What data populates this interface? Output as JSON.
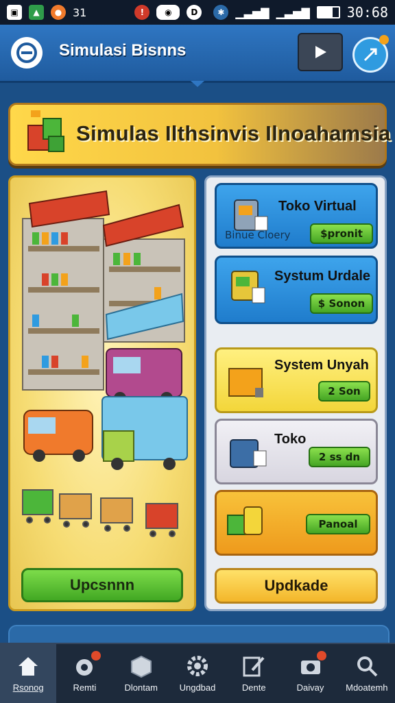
{
  "status_bar": {
    "left_text": "31",
    "time": "30:68"
  },
  "header": {
    "title": "Simulasi Bisnns"
  },
  "banner": {
    "title": "Simulas Ilthsinvis Ilnoahamsia"
  },
  "left_panel": {
    "button_label": "Upcsnnn"
  },
  "cards": [
    {
      "title": "Toko Virtual",
      "subtitle": "Binue Cloery",
      "button": "$pronit",
      "color": "#2a8fdf"
    },
    {
      "title": "Systum Urdale",
      "button": "$ Sonon",
      "color": "#2a8fdf"
    },
    {
      "title": "System Unyah",
      "button": "2 Son",
      "color": "#f6df4a"
    },
    {
      "title": "Toko",
      "button": "2 ss dn",
      "color": "#e4e2ea"
    },
    {
      "button": "Panoal",
      "color": "#f3a520"
    }
  ],
  "right_panel": {
    "button_label": "Updkade"
  },
  "bottom_nav": [
    {
      "label": "Rsonog",
      "icon": "home-icon",
      "active": true
    },
    {
      "label": "Remti",
      "icon": "gamepad-icon",
      "badge": true
    },
    {
      "label": "Dlontam",
      "icon": "box-icon"
    },
    {
      "label": "Ungdbad",
      "icon": "gear-icon"
    },
    {
      "label": "Dente",
      "icon": "edit-icon"
    },
    {
      "label": "Daivay",
      "icon": "camera-icon",
      "badge": true
    },
    {
      "label": "Mdoatemh",
      "icon": "search-icon"
    }
  ]
}
